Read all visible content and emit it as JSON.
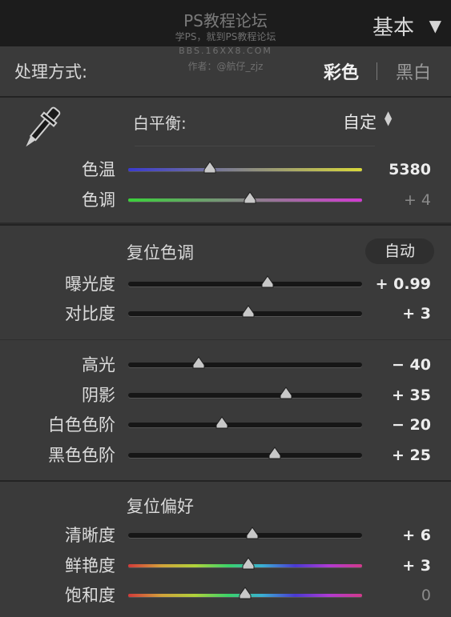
{
  "watermark": {
    "line1": "PS教程论坛",
    "line2": "学PS，就到PS教程论坛",
    "line3": "BBS.16XX8.COM",
    "line4": "作者：@航仔_zjz"
  },
  "panel": {
    "title": "基本",
    "collapse_icon": "triangle-down-icon"
  },
  "treatment": {
    "label": "处理方式:",
    "color_option": "彩色",
    "bw_option": "黑白",
    "selected": "彩色"
  },
  "white_balance": {
    "label": "白平衡:",
    "value": "自定",
    "dropper_icon": "eyedropper-icon",
    "sliders": [
      {
        "label": "色温",
        "display": "5380",
        "position": 0.35,
        "track_gradient": [
          "#3a3ad0",
          "#d8d83a"
        ],
        "dim": false
      },
      {
        "label": "色调",
        "display": "+ 4",
        "position": 0.52,
        "track_gradient": [
          "#3ad23a",
          "#d23ad2"
        ],
        "dim": true
      }
    ]
  },
  "tone": {
    "title": "复位色调",
    "auto_label": "自动",
    "sliders": [
      {
        "label": "曝光度",
        "display": "+ 0.99",
        "position": 0.595,
        "dim": false
      },
      {
        "label": "对比度",
        "display": "+ 3",
        "position": 0.515,
        "dim": false
      }
    ],
    "detail_sliders": [
      {
        "label": "高光",
        "display": "− 40",
        "position": 0.3,
        "dim": false
      },
      {
        "label": "阴影",
        "display": "+ 35",
        "position": 0.675,
        "dim": false
      },
      {
        "label": "白色色阶",
        "display": "− 20",
        "position": 0.4,
        "dim": false
      },
      {
        "label": "黑色色阶",
        "display": "+ 25",
        "position": 0.625,
        "dim": false
      }
    ]
  },
  "presence": {
    "title": "复位偏好",
    "sliders": [
      {
        "label": "清晰度",
        "display": "+ 6",
        "position": 0.53,
        "rainbow": false,
        "dim": false
      },
      {
        "label": "鲜艳度",
        "display": "+ 3",
        "position": 0.515,
        "rainbow": true,
        "dim": false
      },
      {
        "label": "饱和度",
        "display": "0",
        "position": 0.5,
        "rainbow": true,
        "dim": true
      }
    ]
  },
  "colors": {
    "panel_bg": "#3a3a3a",
    "header_bg": "#1c1c1c",
    "thumb": "#c8c8c8",
    "track": "#161616"
  }
}
